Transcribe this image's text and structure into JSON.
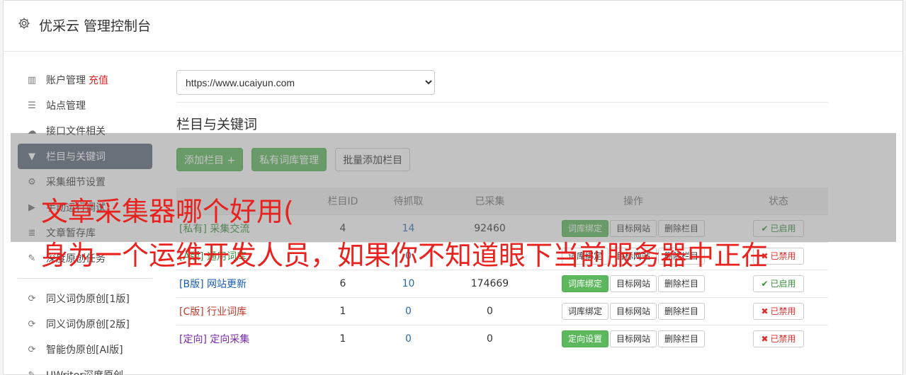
{
  "header": {
    "title": "优采云 管理控制台"
  },
  "sidebar": {
    "items": [
      {
        "label": "账户管理",
        "extra": "充值",
        "icon": "bar-chart-icon"
      },
      {
        "label": "站点管理",
        "icon": "server-icon"
      },
      {
        "label": "接口文件相关",
        "icon": "cloud-download-icon"
      },
      {
        "label": "栏目与关键词",
        "icon": "filter-icon",
        "active": true
      },
      {
        "label": "采集细节设置",
        "icon": "gears-icon"
      },
      {
        "label": "手动运行调试",
        "icon": "play-circle-icon"
      },
      {
        "label": "文章暂存库",
        "icon": "database-icon"
      },
      {
        "label": "深度原创任务",
        "icon": "edit-icon"
      }
    ],
    "items2": [
      {
        "label": "同义词伪原创[1版]",
        "icon": "refresh-icon"
      },
      {
        "label": "同义词伪原创[2版]",
        "icon": "refresh-icon"
      },
      {
        "label": "智能伪原创[AI版]",
        "icon": "refresh-icon"
      },
      {
        "label": "UWriter深度原创",
        "icon": "edit-icon"
      }
    ]
  },
  "main": {
    "site_select": "https://www.ucaiyun.com",
    "section_title": "栏目与关键词",
    "buttons": {
      "add": "添加栏目 +",
      "private_lib": "私有词库管理",
      "batch_add": "批量添加栏目"
    },
    "table": {
      "headers": [
        "",
        "栏目ID",
        "待抓取",
        "已采集",
        "操作",
        "状态"
      ],
      "rows": [
        {
          "tag": "[私有]",
          "name": "采集交流",
          "id": "4",
          "pending": "14",
          "collected": "92460",
          "op1": "词库绑定",
          "op1_green": true,
          "op2": "目标网站",
          "op3": "删除栏目",
          "status": "已启用",
          "on": true,
          "color": "green"
        },
        {
          "tag": "[A版]",
          "name": "通用词库",
          "id": "",
          "pending": "0",
          "collected": "",
          "op1": "词库绑定",
          "op1_green": false,
          "op2": "目标网站",
          "op3": "删除栏目",
          "status": "已禁用",
          "on": false,
          "color": "green"
        },
        {
          "tag": "[B版]",
          "name": "网站更新",
          "id": "6",
          "pending": "10",
          "collected": "174669",
          "op1": "词库绑定",
          "op1_green": true,
          "op2": "目标网站",
          "op3": "删除栏目",
          "status": "已启用",
          "on": true,
          "color": "blue"
        },
        {
          "tag": "[C版]",
          "name": "行业词库",
          "id": "1",
          "pending": "0",
          "collected": "0",
          "op1": "词库绑定",
          "op1_green": false,
          "op2": "目标网站",
          "op3": "删除栏目",
          "status": "已禁用",
          "on": false,
          "color": "red"
        },
        {
          "tag": "[定向]",
          "name": "定向采集",
          "id": "1",
          "pending": "0",
          "collected": "0",
          "op1": "定向设置",
          "op1_green": true,
          "op2": "目标网站",
          "op3": "删除栏目",
          "status": "已禁用",
          "on": false,
          "color": "purple"
        }
      ]
    }
  },
  "overlay": {
    "line1": "文章采集器哪个好用(",
    "line2": "身为一个运维开发人员，如果你不知道眼下当前服务器中正在"
  }
}
